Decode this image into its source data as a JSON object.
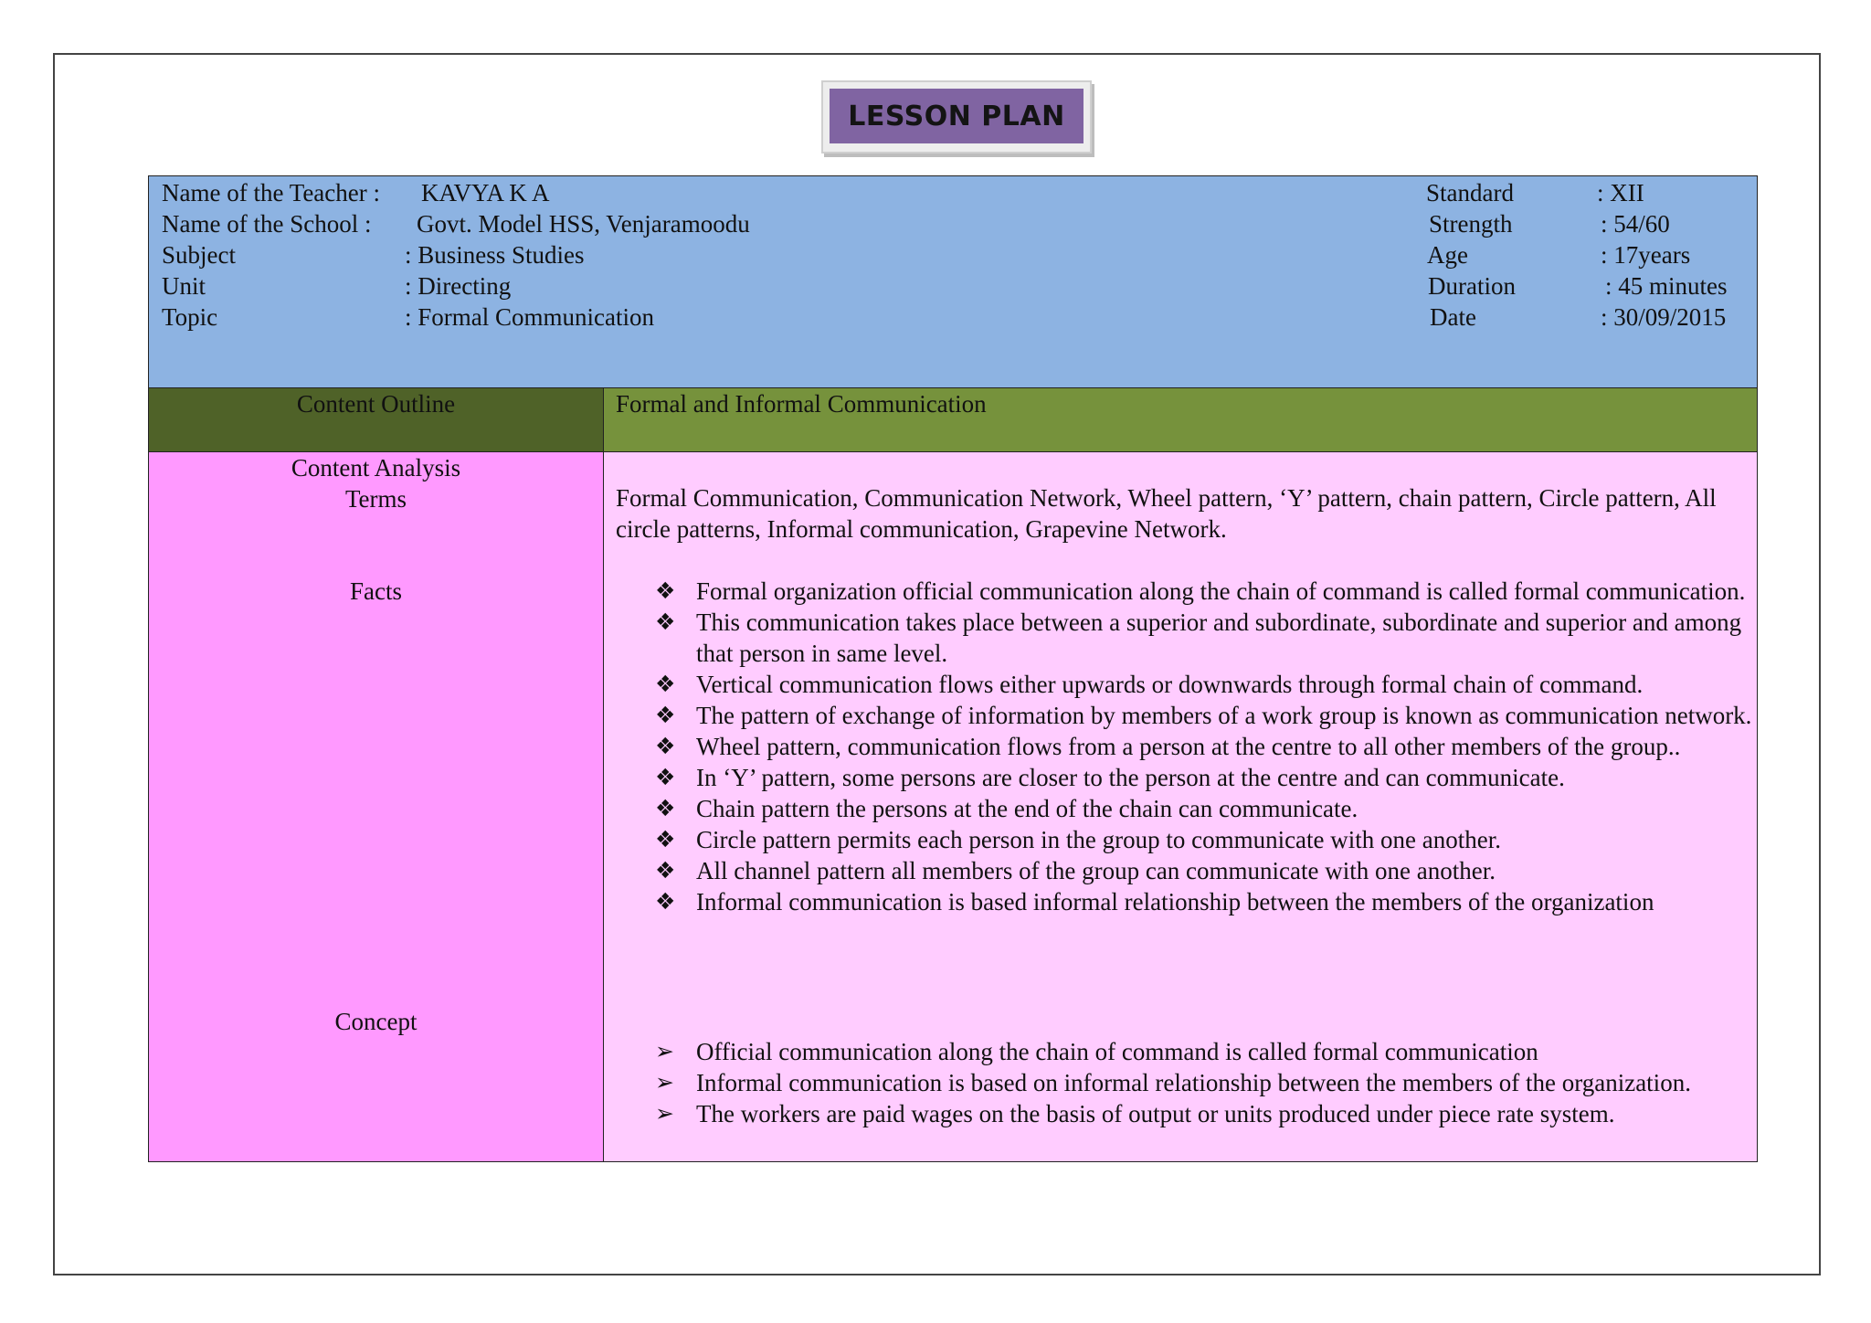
{
  "title": "LESSON PLAN",
  "info": {
    "teacher_label": "Name of the Teacher :",
    "teacher": "KAVYA K A",
    "school_label": "Name of the  School  :",
    "school": "Govt. Model HSS, Venjaramoodu",
    "subject_label": "Subject",
    "subject": ":  Business  Studies",
    "unit_label": "Unit",
    "unit": ": Directing",
    "topic_label": "Topic",
    "topic": ": Formal Communication",
    "standard_label": "Standard",
    "standard": ":   XII",
    "strength_label": "Strength",
    "strength": ":  54/60",
    "age_label": "Age",
    "age": ":  17years",
    "duration_label": "Duration",
    "duration": ":  45 minutes",
    "date_label": "Date",
    "date": ": 30/09/2015"
  },
  "outline": {
    "label": "Content Outline",
    "value": "Formal and Informal Communication"
  },
  "analysis": {
    "label": "Content  Analysis",
    "terms_label": "Terms",
    "terms": "Formal Communication, Communication Network, Wheel pattern, ‘Y’ pattern, chain pattern, Circle pattern, All circle patterns, Informal communication, Grapevine Network.",
    "facts_label": "Facts",
    "fact_bullet": "❖",
    "facts": [
      "Formal organization official communication along the chain of command is called formal communication.",
      "This communication takes place between a superior and subordinate, subordinate and superior and among that person in same level.",
      "Vertical communication flows either upwards or downwards through formal chain of command.",
      "The pattern of exchange of information by members of a work group is known as communication network.",
      "Wheel pattern, communication flows from a person at the centre to all other members of the group..",
      "In ‘Y’ pattern, some persons are closer to the person at the centre and can communicate.",
      "Chain pattern the persons at the end of the chain can communicate.",
      "Circle pattern permits each person in the group to communicate with one another.",
      "All channel pattern all members of the group can communicate with one another.",
      "Informal communication is based informal relationship between the members of the organization"
    ],
    "concept_label": "Concept",
    "concept_bullet": "➢",
    "concepts": [
      "Official communication along the chain of command is called formal communication",
      "Informal communication is based on informal relationship between the members of the organization.",
      "The workers are paid wages on the basis of output or units produced under piece rate system."
    ]
  }
}
